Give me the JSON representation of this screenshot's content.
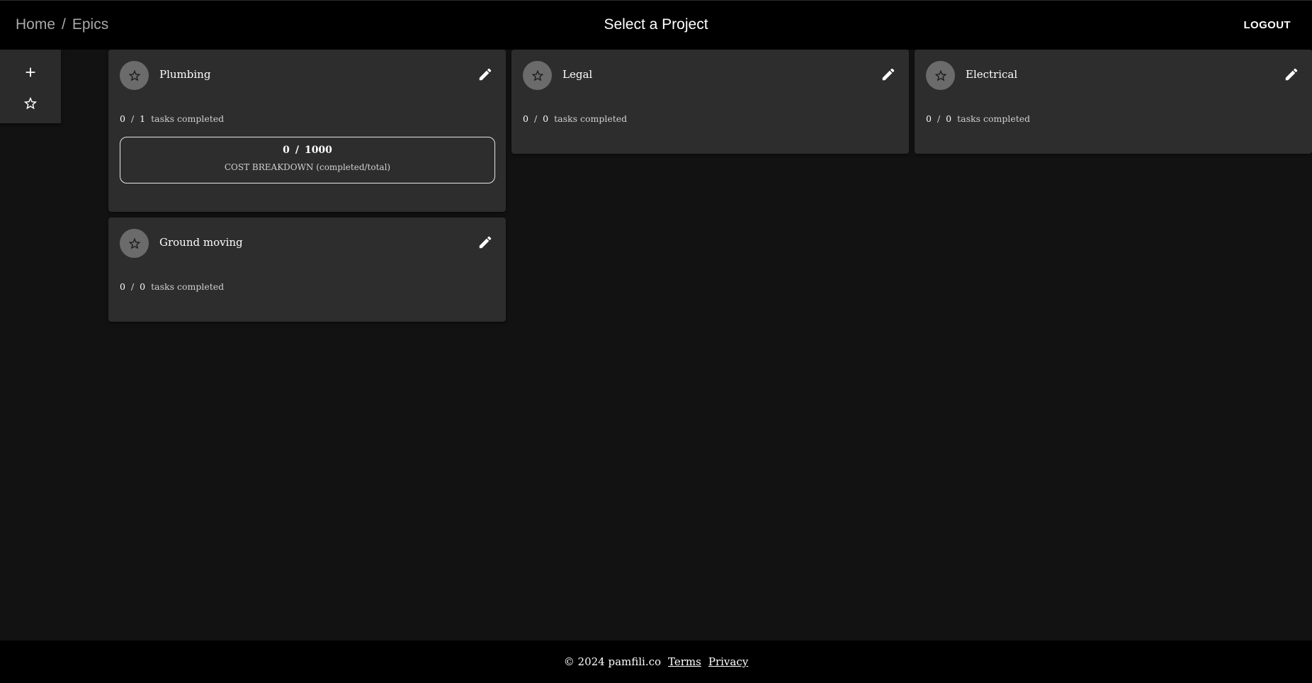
{
  "header": {
    "breadcrumb": [
      {
        "label": "Home"
      },
      {
        "label": "Epics"
      }
    ],
    "breadcrumb_separator": "/",
    "title": "Select a Project",
    "logout_label": "LOGOUT"
  },
  "side_panel": {
    "add_icon": "plus-icon",
    "favorites_icon": "star-outline-icon"
  },
  "cards": [
    {
      "title": "Plumbing",
      "tasks_completed": "0",
      "tasks_total": "1",
      "tasks_label": "tasks completed",
      "cost": {
        "completed": "0",
        "total": "1000",
        "label": "COST BREAKDOWN (completed/total)"
      }
    },
    {
      "title": "Legal",
      "tasks_completed": "0",
      "tasks_total": "0",
      "tasks_label": "tasks completed"
    },
    {
      "title": "Electrical",
      "tasks_completed": "0",
      "tasks_total": "0",
      "tasks_label": "tasks completed"
    },
    {
      "title": "Ground moving",
      "tasks_completed": "0",
      "tasks_total": "0",
      "tasks_label": "tasks completed"
    }
  ],
  "slash": "/",
  "footer": {
    "copyright": "© 2024 pamfili.co",
    "links": [
      {
        "label": "Terms"
      },
      {
        "label": "Privacy"
      }
    ]
  },
  "colors": {
    "background": "#121212",
    "topbar": "#000000",
    "card": "#2d2d2d",
    "fav_circle": "#6b6b6b"
  }
}
